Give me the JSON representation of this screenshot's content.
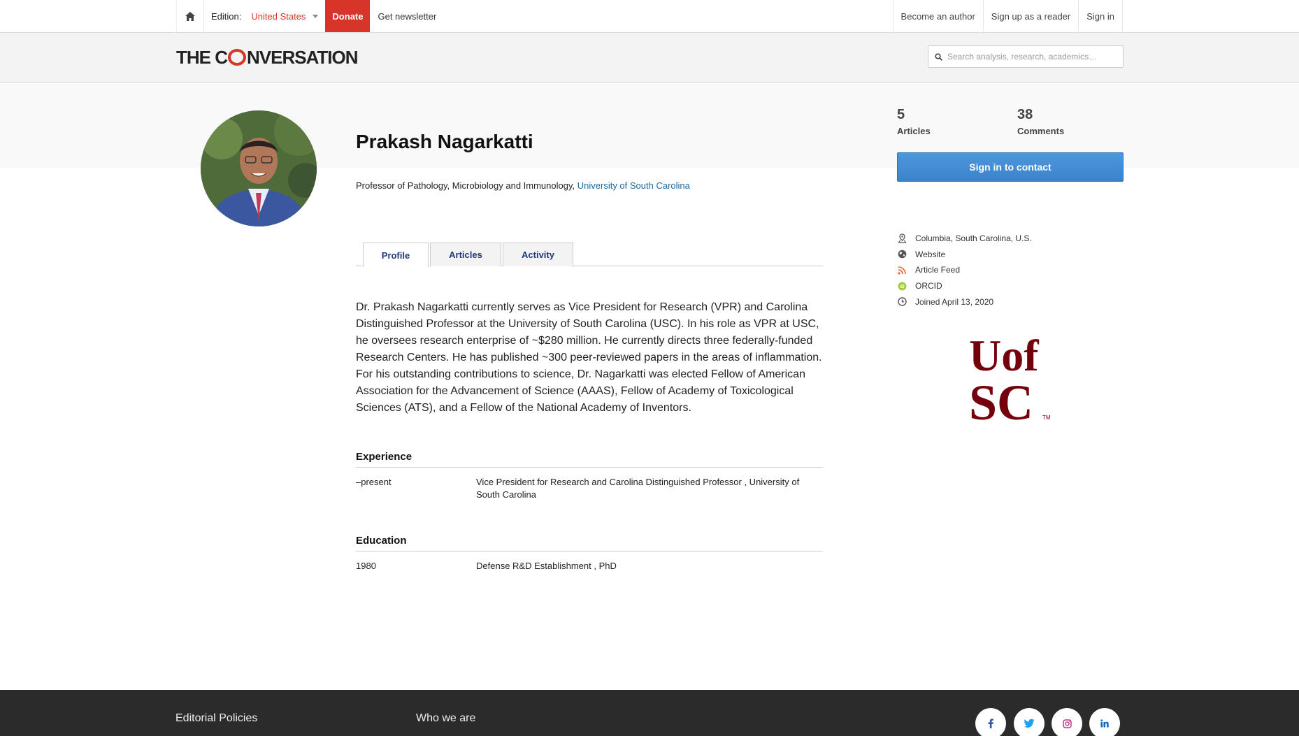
{
  "topnav": {
    "edition_label": "Edition:",
    "edition_value": "United States",
    "donate": "Donate",
    "newsletter": "Get newsletter",
    "become_author": "Become an author",
    "sign_up": "Sign up as a reader",
    "sign_in": "Sign in"
  },
  "header": {
    "logo_before": "THE C",
    "logo_after": "NVERSATION",
    "search_placeholder": "Search analysis, research, academics…"
  },
  "profile": {
    "name": "Prakash Nagarkatti",
    "role": "Professor of Pathology, Microbiology and Immunology,",
    "institution": "University of South Carolina",
    "tabs": [
      {
        "label": "Profile",
        "active": true
      },
      {
        "label": "Articles",
        "active": false
      },
      {
        "label": "Activity",
        "active": false
      }
    ],
    "bio": "Dr. Prakash Nagarkatti currently serves as Vice President for Research (VPR) and Carolina Distinguished Professor at the University of South Carolina (USC). In his role as VPR at USC, he oversees research enterprise of ~$280 million. He currently directs three federally-funded Research Centers. He has published ~300 peer-reviewed papers in the areas of inflammation. For his outstanding contributions to science, Dr. Nagarkatti was elected Fellow of American Association for the Advancement of Science (AAAS), Fellow of Academy of Toxicological Sciences (ATS), and a Fellow of the National Academy of Inventors."
  },
  "experience": {
    "title": "Experience",
    "items": [
      {
        "period": "–present",
        "detail": "Vice President for Research and Carolina Distinguished Professor , University of South Carolina"
      }
    ]
  },
  "education": {
    "title": "Education",
    "items": [
      {
        "year": "1980",
        "detail": "Defense R&D Establishment , PhD"
      }
    ]
  },
  "stats": {
    "articles_count": "5",
    "articles_label": "Articles",
    "comments_count": "38",
    "comments_label": "Comments"
  },
  "contact_button": "Sign in to contact",
  "meta": {
    "location": "Columbia, South Carolina, U.S.",
    "website": "Website",
    "feed": "Article Feed",
    "orcid": "ORCID",
    "joined": "Joined April 13, 2020"
  },
  "usc_logo": {
    "line1": "Uof",
    "line2": "SC",
    "tm": "TM",
    "color": "#73000a"
  },
  "footer": {
    "editorial": "Editorial Policies",
    "who": "Who we are"
  },
  "colors": {
    "accent": "#d8352a",
    "link": "#1a6aa8",
    "button": "#3a83cc"
  }
}
